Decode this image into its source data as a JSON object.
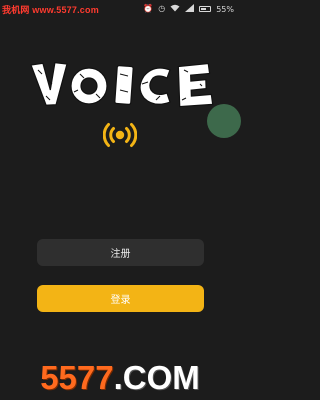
{
  "status_bar": {
    "battery_percent": "55%",
    "icons": [
      "alarm-icon",
      "clock-icon",
      "wifi-icon",
      "signal-icon",
      "battery-icon"
    ]
  },
  "watermark": {
    "top_text": "我机网 www.5577.com",
    "bottom_number": "5577",
    "bottom_domain": ".COM"
  },
  "logo": {
    "text": "VOICE"
  },
  "buttons": {
    "register_label": "注册",
    "login_label": "登录"
  },
  "colors": {
    "background": "#1c1c1c",
    "login_button": "#f3b415",
    "register_button": "#2f2f2f",
    "accent_orange": "#f3b415",
    "floating_ball": "#3f6e4e"
  }
}
